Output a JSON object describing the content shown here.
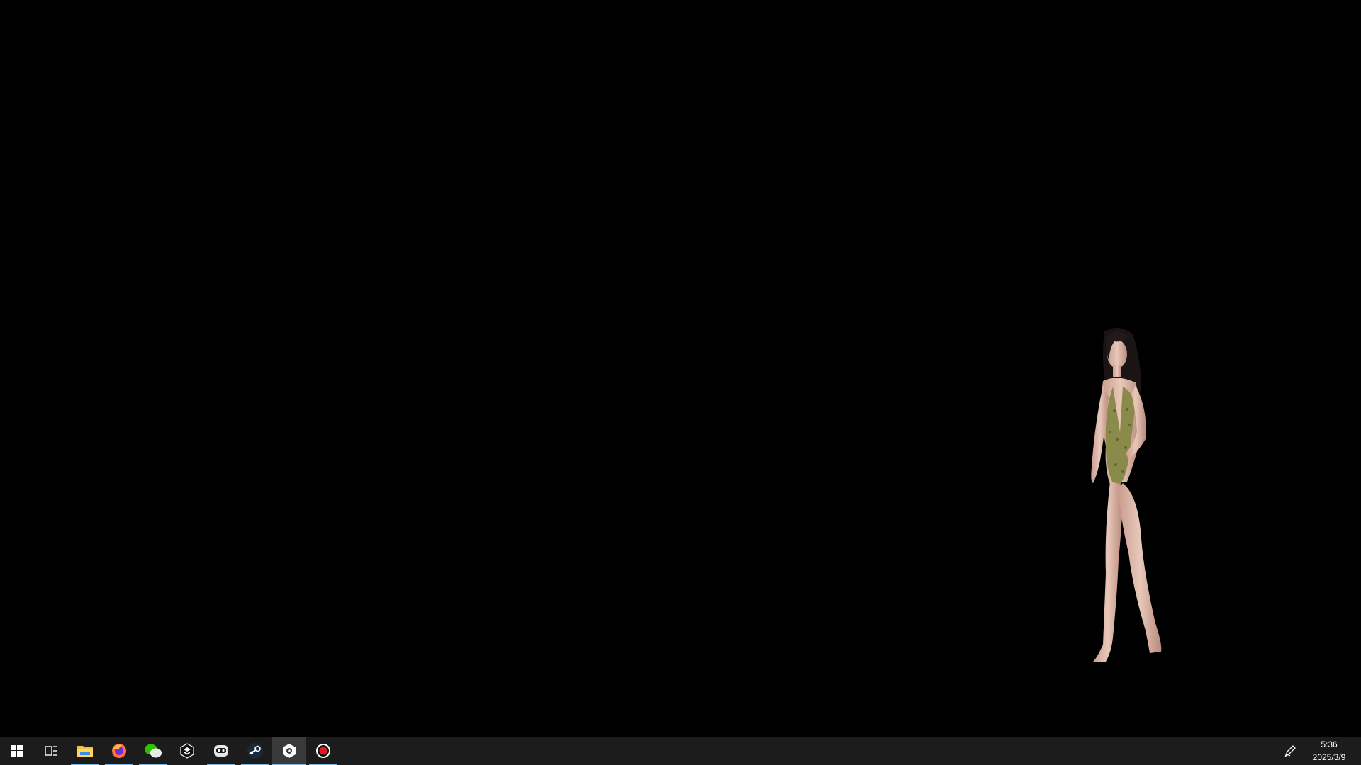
{
  "taskbar": {
    "start": {
      "icon": "windows-icon"
    },
    "task_view": {
      "icon": "task-view-icon"
    },
    "apps": [
      {
        "name": "file-explorer",
        "icon": "folder-icon",
        "running": true,
        "active": false
      },
      {
        "name": "firefox",
        "icon": "firefox-icon",
        "running": true,
        "active": false
      },
      {
        "name": "wechat",
        "icon": "wechat-icon",
        "running": true,
        "active": false
      },
      {
        "name": "app-cube",
        "icon": "cube-icon",
        "running": false,
        "active": false
      },
      {
        "name": "app-robot",
        "icon": "robot-icon",
        "running": true,
        "active": false
      },
      {
        "name": "steam",
        "icon": "steam-icon",
        "running": true,
        "active": false
      },
      {
        "name": "game-engine",
        "icon": "gear-hex-icon",
        "running": true,
        "active": true
      },
      {
        "name": "recorder",
        "icon": "record-icon",
        "running": true,
        "active": false
      }
    ],
    "tray": {
      "pen_icon": "pen-icon",
      "time": "5:36",
      "date": "2025/3/9"
    }
  },
  "colors": {
    "desktop_bg": "#000000",
    "taskbar_bg": "#1c1c1c",
    "running_indicator": "#76b9ed",
    "active_bg": "#3a3a3a"
  }
}
